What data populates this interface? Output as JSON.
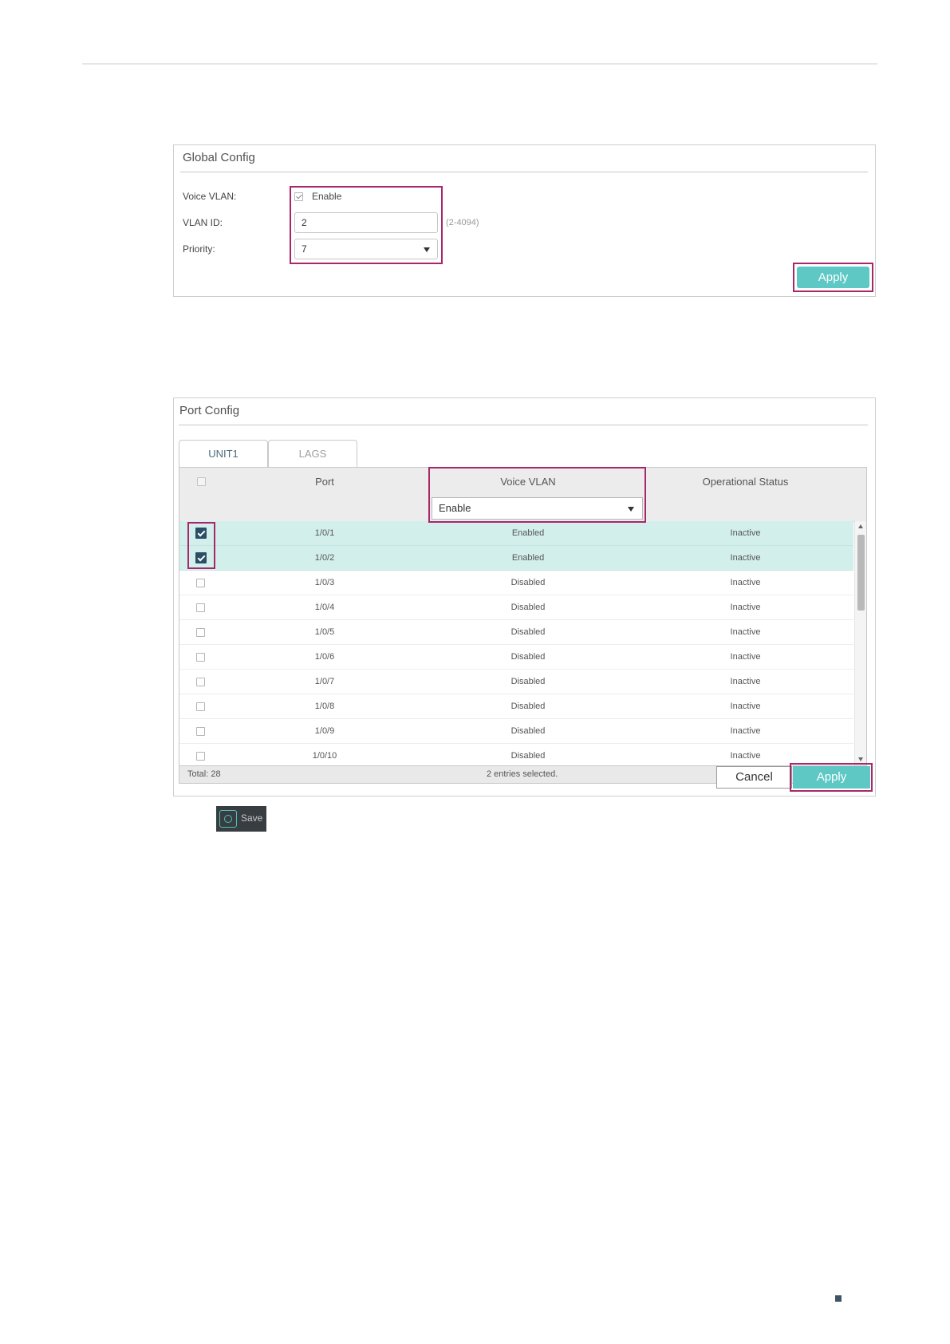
{
  "global_config": {
    "title": "Global Config",
    "voice_vlan_label": "Voice VLAN:",
    "enable_label": "Enable",
    "enable_checked": true,
    "vlan_id_label": "VLAN ID:",
    "vlan_id_value": "2",
    "vlan_id_hint": "(2-4094)",
    "priority_label": "Priority:",
    "priority_value": "7",
    "apply_label": "Apply"
  },
  "port_config": {
    "title": "Port Config",
    "tabs": [
      {
        "label": "UNIT1",
        "active": true
      },
      {
        "label": "LAGS",
        "active": false
      }
    ],
    "columns": {
      "port": "Port",
      "voice_vlan": "Voice VLAN",
      "operational_status": "Operational Status"
    },
    "voice_vlan_filter": "Enable",
    "rows": [
      {
        "port": "1/0/1",
        "voice_vlan": "Enabled",
        "status": "Inactive",
        "selected": true
      },
      {
        "port": "1/0/2",
        "voice_vlan": "Enabled",
        "status": "Inactive",
        "selected": true
      },
      {
        "port": "1/0/3",
        "voice_vlan": "Disabled",
        "status": "Inactive",
        "selected": false
      },
      {
        "port": "1/0/4",
        "voice_vlan": "Disabled",
        "status": "Inactive",
        "selected": false
      },
      {
        "port": "1/0/5",
        "voice_vlan": "Disabled",
        "status": "Inactive",
        "selected": false
      },
      {
        "port": "1/0/6",
        "voice_vlan": "Disabled",
        "status": "Inactive",
        "selected": false
      },
      {
        "port": "1/0/7",
        "voice_vlan": "Disabled",
        "status": "Inactive",
        "selected": false
      },
      {
        "port": "1/0/8",
        "voice_vlan": "Disabled",
        "status": "Inactive",
        "selected": false
      },
      {
        "port": "1/0/9",
        "voice_vlan": "Disabled",
        "status": "Inactive",
        "selected": false
      },
      {
        "port": "1/0/10",
        "voice_vlan": "Disabled",
        "status": "Inactive",
        "selected": false
      }
    ],
    "total_label": "Total: 28",
    "selected_label": "2 entries selected.",
    "cancel_label": "Cancel",
    "apply_label": "Apply"
  },
  "save_button": {
    "label": "Save",
    "icon": "save-gear-icon"
  },
  "colors": {
    "accent": "#5ec8c5",
    "highlight_frame": "#a8276b",
    "selected_row": "#d2efec",
    "checkbox_checked": "#2a4f64",
    "save_bg": "#383d42"
  }
}
